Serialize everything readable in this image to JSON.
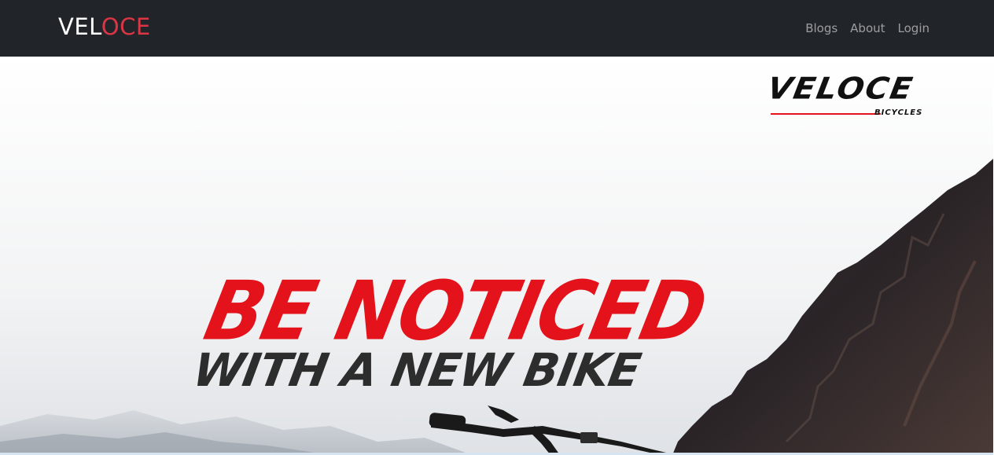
{
  "navbar": {
    "brand_part1": "VEL",
    "brand_part2": "OCE",
    "links": [
      "Blogs",
      "About",
      "Login"
    ]
  },
  "hero": {
    "logo_word": "VELOCE",
    "logo_sub": "BICYCLES",
    "headline": "BE NOTICED",
    "subheadline": "WITH A NEW BIKE"
  },
  "colors": {
    "navbar_bg": "#212529",
    "brand_accent": "#dc3545",
    "headline_red": "#e3121b",
    "subheadline_dark": "#2d2d2d"
  }
}
